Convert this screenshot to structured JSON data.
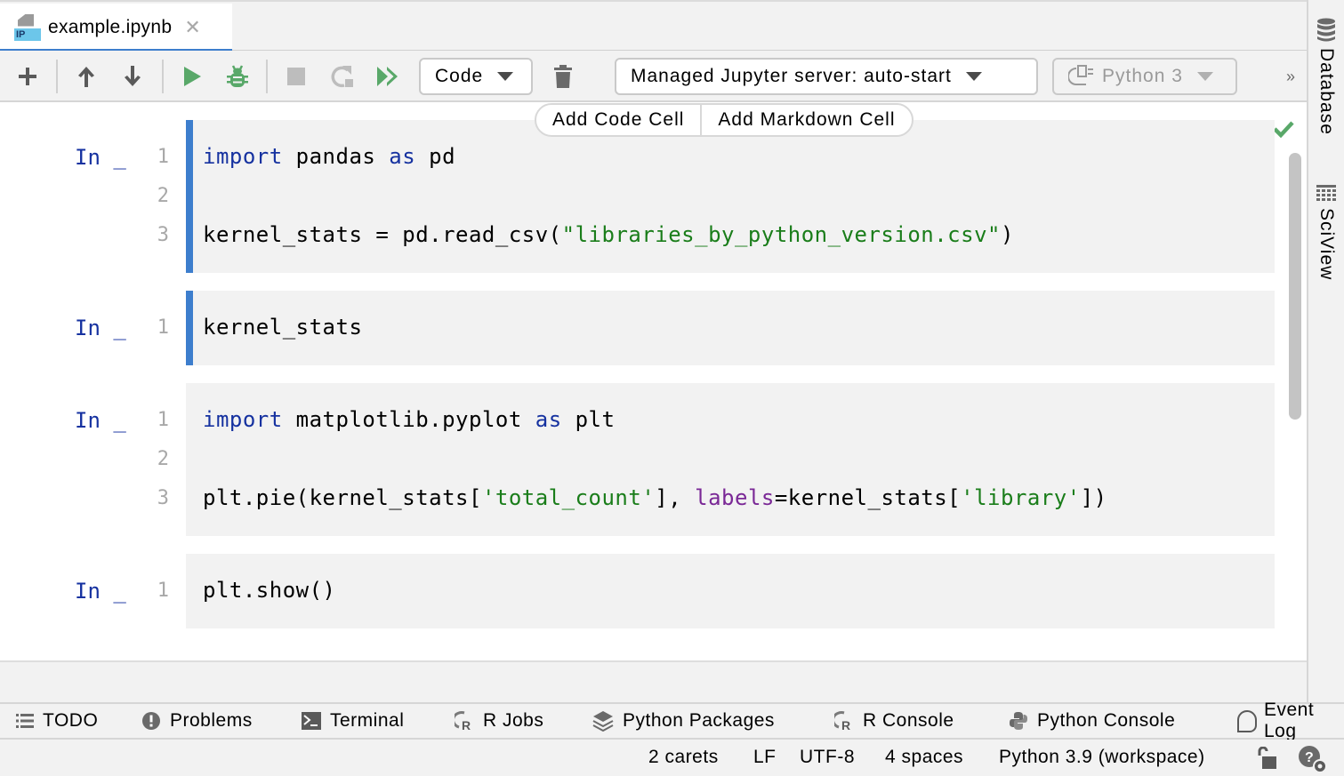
{
  "tab": {
    "title": "example.ipynb",
    "file_icon": "ipynb-file-icon",
    "close_icon": "close-icon"
  },
  "toolbar": {
    "add_icon": "plus-icon",
    "move_up_icon": "arrow-up-icon",
    "move_down_icon": "arrow-down-icon",
    "run_icon": "play-icon",
    "debug_icon": "bug-icon",
    "stop_icon": "stop-icon",
    "restart_icon": "restart-icon",
    "run_all_icon": "run-all-icon",
    "cell_type": "Code",
    "delete_icon": "trash-icon",
    "server": "Managed Jupyter server: auto-start",
    "kernel": "Python 3",
    "more": "»"
  },
  "add_cell_bar": {
    "code": "Add Code Cell",
    "markdown": "Add Markdown Cell"
  },
  "colors": {
    "accent": "#3d7ecd",
    "keyword": "#1632a0",
    "string": "#1a7d1a",
    "param": "#7a2896",
    "run_green": "#59a869"
  },
  "cells": [
    {
      "prompt": "In _",
      "lines": [
        {
          "num": "1",
          "tokens": [
            {
              "t": "import",
              "c": "kw"
            },
            {
              "t": " pandas ",
              "c": ""
            },
            {
              "t": "as",
              "c": "kw"
            },
            {
              "t": " pd",
              "c": ""
            }
          ]
        },
        {
          "num": "2",
          "tokens": []
        },
        {
          "num": "3",
          "tokens": [
            {
              "t": "kernel_stats = pd.read_csv(",
              "c": ""
            },
            {
              "t": "\"libraries_by_python_version.csv\"",
              "c": "str"
            },
            {
              "t": ")",
              "c": ""
            }
          ]
        }
      ]
    },
    {
      "prompt": "In _",
      "lines": [
        {
          "num": "1",
          "tokens": [
            {
              "t": "kernel_stats",
              "c": ""
            }
          ]
        }
      ]
    },
    {
      "prompt": "In _",
      "lines": [
        {
          "num": "1",
          "tokens": [
            {
              "t": "import",
              "c": "kw"
            },
            {
              "t": " matplotlib.pyplot ",
              "c": ""
            },
            {
              "t": "as",
              "c": "kw"
            },
            {
              "t": " plt",
              "c": ""
            }
          ]
        },
        {
          "num": "2",
          "tokens": []
        },
        {
          "num": "3",
          "tokens": [
            {
              "t": "plt.pie(kernel_stats[",
              "c": ""
            },
            {
              "t": "'total_count'",
              "c": "str"
            },
            {
              "t": "], ",
              "c": ""
            },
            {
              "t": "labels",
              "c": "param"
            },
            {
              "t": "=kernel_stats[",
              "c": ""
            },
            {
              "t": "'library'",
              "c": "str"
            },
            {
              "t": "])",
              "c": ""
            }
          ]
        }
      ]
    },
    {
      "prompt": "In _",
      "lines": [
        {
          "num": "1",
          "tokens": [
            {
              "t": "plt.show()",
              "c": ""
            }
          ]
        }
      ]
    }
  ],
  "right_tools": [
    {
      "label": "Database",
      "icon": "database-icon"
    },
    {
      "label": "SciView",
      "icon": "sciview-icon"
    }
  ],
  "bottom_tools": [
    {
      "label": "TODO",
      "icon": "list-icon"
    },
    {
      "label": "Problems",
      "icon": "problems-icon"
    },
    {
      "label": "Terminal",
      "icon": "terminal-icon"
    },
    {
      "label": "R Jobs",
      "icon": "r-icon"
    },
    {
      "label": "Python Packages",
      "icon": "layers-icon"
    },
    {
      "label": "R Console",
      "icon": "r-icon"
    },
    {
      "label": "Python Console",
      "icon": "python-icon"
    },
    {
      "label": "Event Log",
      "icon": "event-log-icon"
    }
  ],
  "status": {
    "carets": "2 carets",
    "line_sep": "LF",
    "encoding": "UTF-8",
    "indent": "4 spaces",
    "interpreter": "Python 3.9 (workspace)",
    "lock_icon": "unlock-icon",
    "inspector_icon": "inspector-icon"
  }
}
